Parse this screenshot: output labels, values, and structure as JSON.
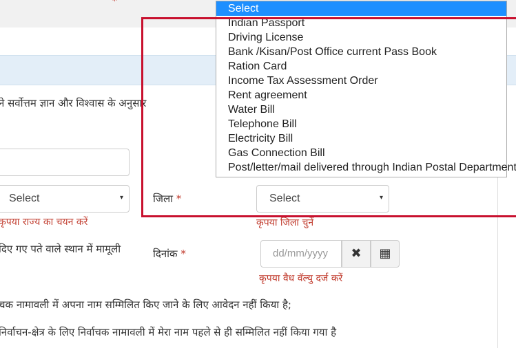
{
  "top_marker": "*",
  "intro_text": "ने सर्वोत्तम ज्ञान और विश्वास के अनुसार",
  "state_select": {
    "value": "Select",
    "arrow": "▾",
    "error": "कृपया राज्य का चयन करें"
  },
  "district": {
    "label": "जिला",
    "required_mark": "*",
    "value": "Select",
    "arrow": "▾",
    "error": "कृपया जिला चुनें"
  },
  "address_note": "दिए गए पते वाले स्थान में मामूली",
  "date": {
    "label": "दिनांक",
    "required_mark": "*",
    "placeholder": "dd/mm/yyyy",
    "clear_symbol": "✖",
    "calendar_symbol": "▦",
    "error": "कृपया वैध वॅल्यु दर्ज करें"
  },
  "declaration_1": "चक नामावली में अपना नाम सम्मिलित किए जाने के लिए आवेदन नहीं किया है;",
  "declaration_2": "निर्वाचन-क्षेत्र के लिए निर्वाचक नामावली में मेरा नाम पहले से ही सम्मिलित नहीं किया गया है",
  "document_dropdown": {
    "options": [
      "Select",
      "Indian Passport",
      "Driving License",
      "Bank /Kisan/Post Office current Pass Book",
      "Ration Card",
      "Income Tax Assessment Order",
      "Rent agreement",
      "Water Bill",
      "Telephone Bill",
      "Electricity Bill",
      "Gas Connection Bill",
      "Post/letter/mail delivered through Indian Postal Department"
    ],
    "highlighted": "Select"
  },
  "colors": {
    "highlight": "#1e8fff",
    "error": "#c0392b",
    "annotation_box": "#c8102e"
  }
}
